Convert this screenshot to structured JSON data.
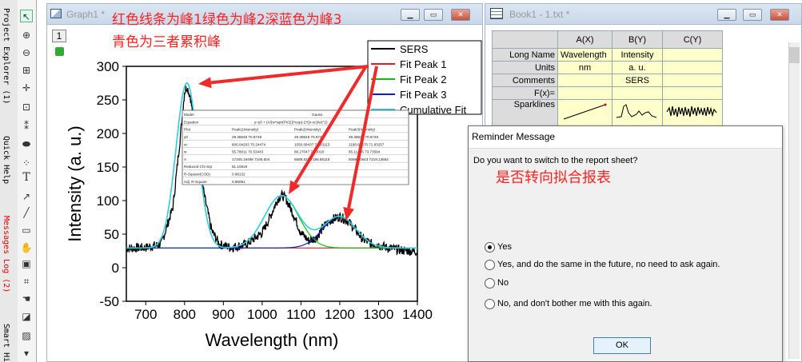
{
  "sidebar": {
    "tabs": [
      "Project Explorer (1)",
      "Quick Help",
      "Messages Log (2)",
      "Smart Hi"
    ]
  },
  "graph": {
    "title": "Graph1 *",
    "layer_index": "1",
    "annotation_line1": "红色线条为峰1绿色为峰2深蓝色为峰3",
    "annotation_line2": "青色为三者累积峰"
  },
  "chart_data": {
    "type": "line",
    "xlabel": "Wavelength (nm)",
    "ylabel": "Intensity (a. u.)",
    "xlim": [
      650,
      1400
    ],
    "ylim": [
      -50,
      300
    ],
    "xticks": [
      700,
      800,
      900,
      1000,
      1100,
      1200,
      1300,
      1400
    ],
    "yticks": [
      -50,
      0,
      50,
      100,
      150,
      200,
      250,
      300
    ],
    "legend": [
      "SERS",
      "Fit Peak 1",
      "Fit Peak 2",
      "Fit Peak 3",
      "Cumulative Fit"
    ],
    "legend_position": "top-right",
    "colors": {
      "SERS": "#000000",
      "Fit Peak 1": "#e02020",
      "Fit Peak 2": "#10c010",
      "Fit Peak 3": "#1020c0",
      "Cumulative Fit": "#30d0e0"
    },
    "baseline": 29.4,
    "peaks": [
      {
        "name": "Fit Peak 1",
        "center": 806,
        "height": 246,
        "width": 55.8
      },
      {
        "name": "Fit Peak 2",
        "center": 1050,
        "height": 78,
        "width": 88
      },
      {
        "name": "Fit Peak 3",
        "center": 1199,
        "height": 47,
        "width": 85
      }
    ],
    "series_sample": {
      "x": [
        660,
        700,
        740,
        770,
        790,
        800,
        806,
        815,
        830,
        850,
        870,
        890,
        920,
        960,
        1000,
        1020,
        1040,
        1050,
        1060,
        1080,
        1100,
        1120,
        1140,
        1160,
        1180,
        1200,
        1220,
        1240,
        1260,
        1280,
        1300,
        1320,
        1340,
        1360,
        1380,
        1400
      ],
      "y": [
        29,
        30,
        35,
        90,
        200,
        262,
        270,
        255,
        190,
        110,
        55,
        35,
        30,
        35,
        52,
        75,
        102,
        108,
        104,
        80,
        52,
        40,
        45,
        62,
        72,
        76,
        70,
        57,
        42,
        36,
        34,
        30,
        28,
        26,
        25,
        24
      ]
    },
    "table": {
      "headers": [
        "Model",
        "",
        "Gauss"
      ],
      "rows": [
        [
          "Equation",
          "y=y0 + (A/(w*sqrt(PI/2)))*exp(-2*((x-xc)/w)^2)",
          ""
        ],
        [
          "Plot",
          "Peak1(Intensity)",
          "Peak2(Intensity)",
          "Peak3(Intensity)"
        ],
        [
          "y0",
          "29.38648 70.8749",
          "29.38648 70.8749",
          "29.38648 70.8749"
        ],
        [
          "xc",
          "806.04203 70.24474",
          "1050.08437 70.93113",
          "1198.69670 71.83257"
        ],
        [
          "w",
          "55.78011 70.53443",
          "88.27047 72.0018",
          "85.11455 73.73594"
        ],
        [
          "A",
          "17345.19498 7165.504",
          "6588.823 7186.85115",
          "5089.10643 7219.13654"
        ],
        [
          "Reduced Chi-Sqr",
          "81.10619",
          "",
          ""
        ],
        [
          "R-Square(COD)",
          "0.98132",
          "",
          ""
        ],
        [
          "Adj. R-Square",
          "0.98091",
          "",
          ""
        ]
      ]
    }
  },
  "book": {
    "title": "Book1 - 1.txt *",
    "columns": [
      "A(X)",
      "B(Y)",
      "C(Y)"
    ],
    "rows": [
      {
        "label": "Long Name",
        "cells": [
          "Wavelength",
          "Intensity",
          ""
        ]
      },
      {
        "label": "Units",
        "cells": [
          "nm",
          "a. u.",
          ""
        ]
      },
      {
        "label": "Comments",
        "cells": [
          "",
          "SERS",
          ""
        ]
      },
      {
        "label": "F(x)=",
        "cells": [
          "",
          "",
          ""
        ]
      },
      {
        "label": "Sparklines",
        "cells": [
          "",
          "",
          ""
        ]
      }
    ]
  },
  "dialog": {
    "title": "Reminder Message",
    "question": "Do you want to switch to the report sheet?",
    "annotation": "是否转向拟合报表",
    "options": [
      "Yes",
      "Yes, and do the same in the future, no need to ask again.",
      "No",
      "No, and don't bother me with this again."
    ],
    "selected_index": 0,
    "ok_label": "OK"
  }
}
